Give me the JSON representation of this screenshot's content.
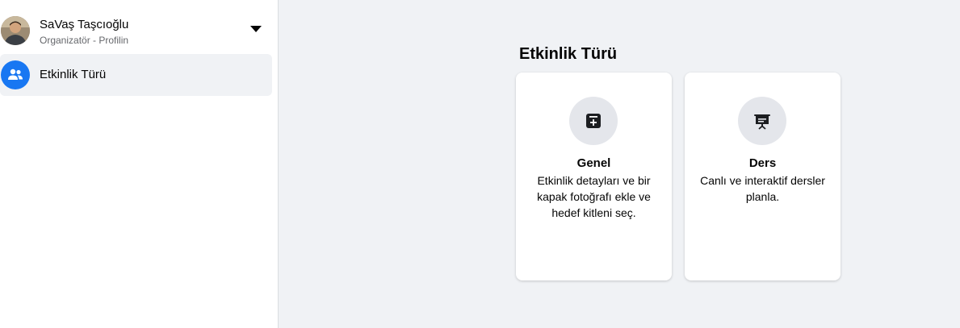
{
  "sidebar": {
    "profile": {
      "name": "SaVaş Taşcıoğlu",
      "subtitle": "Organizatör - Profilin"
    },
    "items": [
      {
        "label": "Etkinlik Türü",
        "icon": "people-icon",
        "selected": true
      }
    ]
  },
  "main": {
    "title": "Etkinlik Türü",
    "cards": [
      {
        "title": "Genel",
        "description": "Etkinlik detayları ve bir kapak fotoğrafı ekle ve hedef kitleni seç.",
        "icon": "calendar-plus-icon"
      },
      {
        "title": "Ders",
        "description": "Canlı ve interaktif dersler planla.",
        "icon": "presentation-icon"
      }
    ]
  },
  "colors": {
    "accent": "#1877f2",
    "background": "#f0f2f5",
    "card": "#ffffff",
    "icon_circle": "#e4e6eb"
  }
}
